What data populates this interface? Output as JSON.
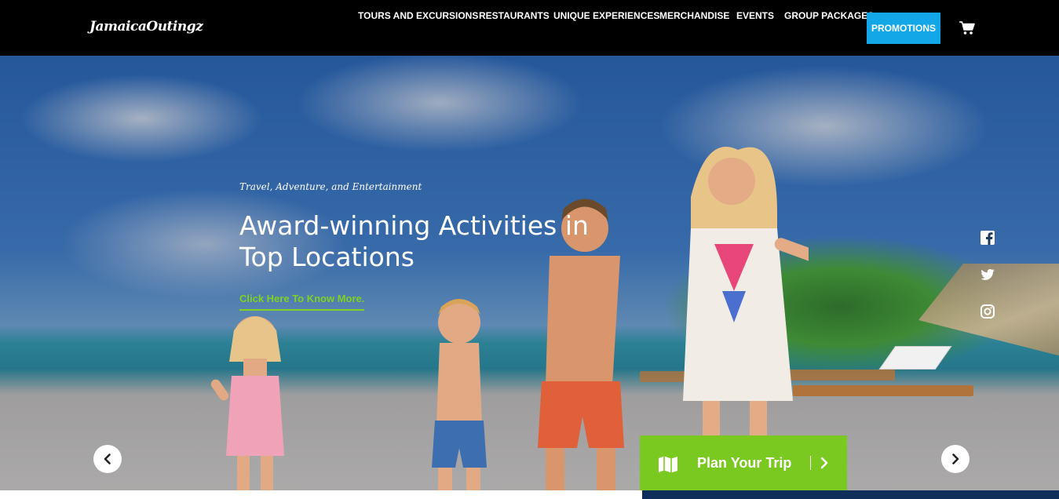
{
  "header": {
    "logo": "JamaicaOutingz",
    "nav": [
      {
        "label": "TOURS AND EXCURSIONS"
      },
      {
        "label": "RESTAURANTS"
      },
      {
        "label": "UNIQUE EXPERIENCES"
      },
      {
        "label": "MERCHANDISE"
      },
      {
        "label": "EVENTS"
      },
      {
        "label": "GROUP PACKAGES"
      }
    ],
    "promotions": "PROMOTIONS",
    "cart_icon": "cart-icon"
  },
  "hero": {
    "subtitle": "Travel, Adventure, and Entertainment",
    "title": "Award-winning Activities in Top Locations",
    "link": "Click Here To Know More."
  },
  "social": [
    "facebook-icon",
    "twitter-icon",
    "instagram-icon"
  ],
  "plan_trip": {
    "label": "Plan Your Trip",
    "icon": "map-icon"
  },
  "colors": {
    "header_bg": "#000000",
    "promo_bg": "#14a7e8",
    "accent_green": "#7ac921",
    "link_green": "#7ed321"
  }
}
